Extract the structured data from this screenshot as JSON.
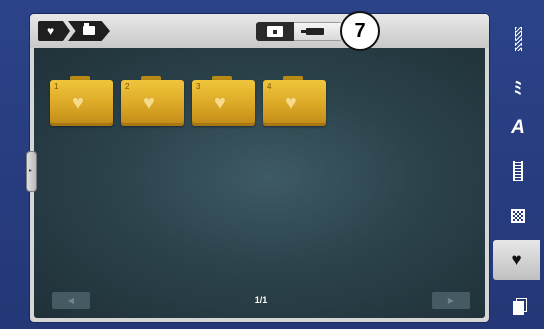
{
  "breadcrumb": {
    "items": [
      {
        "icon": "heart-icon",
        "glyph": "♥"
      },
      {
        "icon": "folder-icon"
      }
    ]
  },
  "source_toggle": {
    "options": [
      {
        "icon": "machine-memory-icon",
        "selected": true
      },
      {
        "icon": "usb-stick-icon",
        "selected": false
      }
    ]
  },
  "callout_badge": "7",
  "folders": [
    {
      "number": "1",
      "icon": "heart-icon",
      "glyph": "♥"
    },
    {
      "number": "2",
      "icon": "heart-icon",
      "glyph": "♥"
    },
    {
      "number": "3",
      "icon": "heart-icon",
      "glyph": "♥"
    },
    {
      "number": "4",
      "icon": "heart-icon",
      "glyph": "♥"
    }
  ],
  "pagination": {
    "indicator": "1/1",
    "prev_icon": "arrow-left-icon",
    "next_icon": "arrow-right-icon",
    "prev_glyph": "◀",
    "next_glyph": "▶"
  },
  "side_handle_glyph": "▸",
  "sidebar": {
    "items": [
      {
        "icon": "practical-stitch-icon"
      },
      {
        "icon": "decorative-stitch-icon",
        "glyph": "ﾐ"
      },
      {
        "icon": "alphabet-icon",
        "glyph": "A"
      },
      {
        "icon": "buttonhole-icon"
      },
      {
        "icon": "quilt-stitch-icon"
      },
      {
        "icon": "personal-program-icon",
        "glyph": "♥",
        "active": true
      },
      {
        "icon": "memory-icon"
      }
    ]
  },
  "colors": {
    "background": "#2a3f84",
    "frame": "#d6d6d6",
    "content": "#2c434c",
    "folder": "#dba726"
  }
}
